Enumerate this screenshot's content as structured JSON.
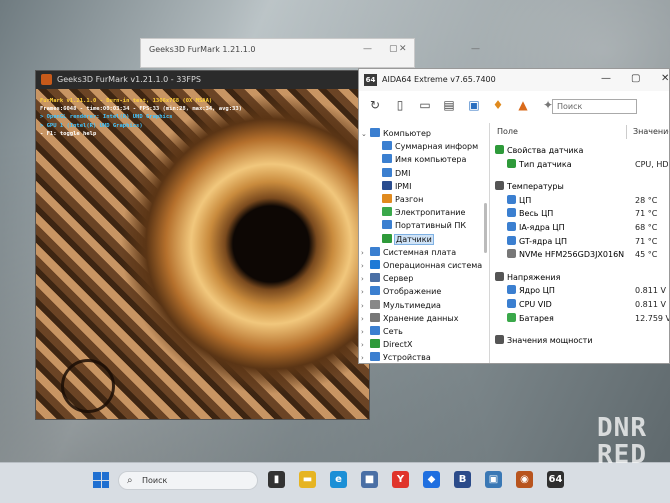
{
  "ghost_window": {
    "title": "Geeks3D FurMark 1.21.1.0"
  },
  "furmark": {
    "title": "Geeks3D FurMark v1.21.1.0 - 33FPS",
    "osd": [
      {
        "text": "FurMark v1.21.1.0 - Burn-in test, 1366x768 (0X MSAA)",
        "color": "#ffd23a"
      },
      {
        "text": "Frames:6048 - time:00:03:34 - FPS:33 (min:28, max:34, avg:33)",
        "color": "#ffffff"
      },
      {
        "text": "> OpenGL renderer: Intel(R) UHD Graphics",
        "color": "#43c6ff"
      },
      {
        "text": "> GPU 1 (Intel(R) UHD Graphics)",
        "color": "#43c6ff"
      },
      {
        "text": "- F1: toggle help",
        "color": "#ffffff"
      }
    ]
  },
  "aida": {
    "title": "AIDA64 Extreme v7.65.7400",
    "logo_text": "64",
    "search_placeholder": "Поиск",
    "tree": [
      {
        "label": "Компьютер",
        "level": 0,
        "expander": "v",
        "icon_color": "#3b7fd0",
        "selected": false
      },
      {
        "label": "Суммарная информ",
        "level": 1,
        "expander": "",
        "icon_color": "#3b7fd0",
        "selected": false
      },
      {
        "label": "Имя компьютера",
        "level": 1,
        "expander": "",
        "icon_color": "#3b7fd0",
        "selected": false
      },
      {
        "label": "DMI",
        "level": 1,
        "expander": "",
        "icon_color": "#3b7fd0",
        "selected": false
      },
      {
        "label": "IPMI",
        "level": 1,
        "expander": "",
        "icon_color": "#2a4d8f",
        "selected": false
      },
      {
        "label": "Разгон",
        "level": 1,
        "expander": "",
        "icon_color": "#e08a1e",
        "selected": false
      },
      {
        "label": "Электропитание",
        "level": 1,
        "expander": "",
        "icon_color": "#3aa84a",
        "selected": false
      },
      {
        "label": "Портативный ПК",
        "level": 1,
        "expander": "",
        "icon_color": "#3b7fd0",
        "selected": false
      },
      {
        "label": "Датчики",
        "level": 1,
        "expander": "",
        "icon_color": "#2e9a3a",
        "selected": true
      },
      {
        "label": "Системная плата",
        "level": 0,
        "expander": ">",
        "icon_color": "#3b7fd0",
        "selected": false
      },
      {
        "label": "Операционная система",
        "level": 0,
        "expander": ">",
        "icon_color": "#1e7ad6",
        "selected": false
      },
      {
        "label": "Сервер",
        "level": 0,
        "expander": ">",
        "icon_color": "#4a6fa5",
        "selected": false
      },
      {
        "label": "Отображение",
        "level": 0,
        "expander": ">",
        "icon_color": "#3b7fd0",
        "selected": false
      },
      {
        "label": "Мультимедиа",
        "level": 0,
        "expander": ">",
        "icon_color": "#888888",
        "selected": false
      },
      {
        "label": "Хранение данных",
        "level": 0,
        "expander": ">",
        "icon_color": "#777777",
        "selected": false
      },
      {
        "label": "Сеть",
        "level": 0,
        "expander": ">",
        "icon_color": "#3b7fd0",
        "selected": false
      },
      {
        "label": "DirectX",
        "level": 0,
        "expander": ">",
        "icon_color": "#2e9a3a",
        "selected": false
      },
      {
        "label": "Устройства",
        "level": 0,
        "expander": ">",
        "icon_color": "#3b7fd0",
        "selected": false
      }
    ],
    "columns": {
      "field": "Поле",
      "value": "Значение"
    },
    "rows": [
      {
        "kind": "group",
        "label": "Свойства датчика",
        "value": "",
        "icon_color": "#2e9a3a"
      },
      {
        "kind": "item",
        "label": "Тип датчика",
        "value": "CPU, HDD",
        "icon_color": "#2e9a3a"
      },
      {
        "kind": "gap",
        "label": "",
        "value": "",
        "icon_color": ""
      },
      {
        "kind": "group",
        "label": "Температуры",
        "value": "",
        "icon_color": "#555555"
      },
      {
        "kind": "item",
        "label": "ЦП",
        "value": "28 °C",
        "icon_color": "#3b7fd0"
      },
      {
        "kind": "item",
        "label": "Весь ЦП",
        "value": "71 °C",
        "icon_color": "#3b7fd0"
      },
      {
        "kind": "item",
        "label": "IA-ядра ЦП",
        "value": "68 °C",
        "icon_color": "#3b7fd0"
      },
      {
        "kind": "item",
        "label": "GT-ядра ЦП",
        "value": "71 °C",
        "icon_color": "#3b7fd0"
      },
      {
        "kind": "item",
        "label": "NVMe HFM256GD3JX016N",
        "value": "45 °C",
        "icon_color": "#777777"
      },
      {
        "kind": "gap",
        "label": "",
        "value": "",
        "icon_color": ""
      },
      {
        "kind": "group",
        "label": "Напряжения",
        "value": "",
        "icon_color": "#555555"
      },
      {
        "kind": "item",
        "label": "Ядро ЦП",
        "value": "0.811 V",
        "icon_color": "#3b7fd0"
      },
      {
        "kind": "item",
        "label": "CPU VID",
        "value": "0.811 V",
        "icon_color": "#3b7fd0"
      },
      {
        "kind": "item",
        "label": "Батарея",
        "value": "12.759 V",
        "icon_color": "#3aa84a"
      },
      {
        "kind": "gap",
        "label": "",
        "value": "",
        "icon_color": ""
      },
      {
        "kind": "group",
        "label": "Значения мощности",
        "value": "",
        "icon_color": "#555555"
      }
    ]
  },
  "taskbar": {
    "search_label": "Поиск",
    "apps": [
      {
        "name": "task-view",
        "glyph": "▮",
        "color": "#333333"
      },
      {
        "name": "file-explorer",
        "glyph": "▬",
        "color": "#e6b422"
      },
      {
        "name": "edge",
        "glyph": "e",
        "color": "#1b8fd6"
      },
      {
        "name": "microsoft-store",
        "glyph": "■",
        "color": "#4a6fa5"
      },
      {
        "name": "yandex-browser",
        "glyph": "Y",
        "color": "#e0342b"
      },
      {
        "name": "dropbox",
        "glyph": "◆",
        "color": "#1f6fe0"
      },
      {
        "name": "b-app",
        "glyph": "B",
        "color": "#2b4b8a"
      },
      {
        "name": "network-app",
        "glyph": "▣",
        "color": "#3a78b5"
      },
      {
        "name": "furmark",
        "glyph": "◉",
        "color": "#b8541e"
      },
      {
        "name": "aida64",
        "glyph": "64",
        "color": "#2f2f2f"
      }
    ]
  },
  "watermark": {
    "line1": "DNR",
    "line2": "RED"
  }
}
